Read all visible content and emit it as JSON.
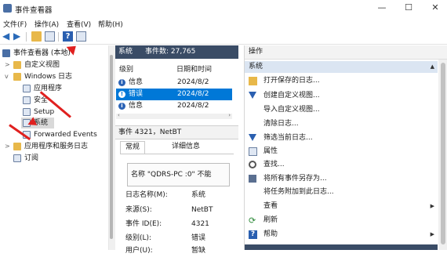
{
  "window": {
    "title": "事件查看器",
    "min": "—",
    "max": "☐",
    "close": "✕"
  },
  "menu": [
    "文件(F)",
    "操作(A)",
    "查看(V)",
    "帮助(H)"
  ],
  "tree": {
    "root": "事件查看器 (本地)",
    "custom_views": "自定义视图",
    "windows_logs": "Windows 日志",
    "app": "应用程序",
    "security": "安全",
    "setup": "Setup",
    "system": "系统",
    "forwarded": "Forwarded Events",
    "app_services": "应用程序和服务日志",
    "subscriptions": "订阅"
  },
  "list": {
    "log_name": "系统",
    "event_count": "事件数: 27,765",
    "col_level": "级别",
    "col_date": "日期和时间",
    "rows": [
      {
        "level": "信息",
        "date": "2024/8/2 10:55:5"
      },
      {
        "level": "错误",
        "date": "2024/8/2 10:53:5"
      },
      {
        "level": "信息",
        "date": "2024/8/2 10:52:0"
      }
    ]
  },
  "detail": {
    "header": "事件 4321，NetBT",
    "tab_general": "常规",
    "tab_details": "详细信息",
    "description": "名称 \"QDRS-PC    :0\" 不能",
    "props": [
      {
        "label": "日志名称(M):",
        "value": "系统"
      },
      {
        "label": "来源(S):",
        "value": "NetBT"
      },
      {
        "label": "事件 ID(E):",
        "value": "4321"
      },
      {
        "label": "级别(L):",
        "value": "错误"
      },
      {
        "label": "用户(U):",
        "value": "暂缺"
      }
    ]
  },
  "actions": {
    "header": "操作",
    "section": "系统",
    "items": [
      {
        "label": "打开保存的日志...",
        "icon": "open-log-icon"
      },
      {
        "label": "创建自定义视图...",
        "icon": "filter-icon"
      },
      {
        "label": "导入自定义视图...",
        "icon": ""
      },
      {
        "label": "清除日志...",
        "icon": ""
      },
      {
        "label": "筛选当前日志...",
        "icon": "filter-icon"
      },
      {
        "label": "属性",
        "icon": "properties-icon"
      },
      {
        "label": "查找...",
        "icon": "find-icon"
      },
      {
        "label": "将所有事件另存为...",
        "icon": "save-icon"
      },
      {
        "label": "将任务附加到此日志...",
        "icon": ""
      },
      {
        "label": "查看",
        "icon": "",
        "submenu": true
      },
      {
        "label": "刷新",
        "icon": "refresh-icon"
      },
      {
        "label": "帮助",
        "icon": "help-icon",
        "submenu": true
      }
    ]
  },
  "colors": {
    "header_bg": "#3a4c66",
    "selection": "#0078d7",
    "annotation_arrow": "#e0201f"
  }
}
